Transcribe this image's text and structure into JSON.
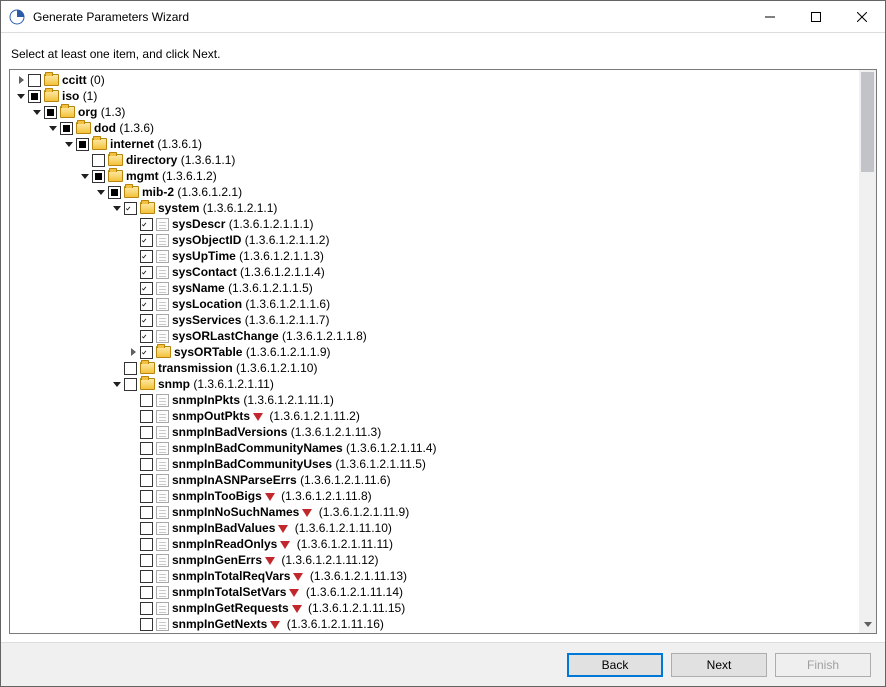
{
  "window": {
    "title": "Generate Parameters Wizard"
  },
  "instruction": "Select at least one item, and click Next.",
  "buttons": {
    "back": "Back",
    "next": "Next",
    "finish": "Finish"
  },
  "tree": [
    {
      "id": "ccitt",
      "depth": 0,
      "toggle": "collapsed",
      "check": "empty",
      "icon": "folder",
      "name": "ccitt",
      "oid": "(0)"
    },
    {
      "id": "iso",
      "depth": 0,
      "toggle": "expanded",
      "check": "partial",
      "icon": "folder",
      "name": "iso",
      "oid": "(1)"
    },
    {
      "id": "org",
      "depth": 1,
      "toggle": "expanded",
      "check": "partial",
      "icon": "folder",
      "name": "org",
      "oid": "(1.3)"
    },
    {
      "id": "dod",
      "depth": 2,
      "toggle": "expanded",
      "check": "partial",
      "icon": "folder",
      "name": "dod",
      "oid": "(1.3.6)"
    },
    {
      "id": "internet",
      "depth": 3,
      "toggle": "expanded",
      "check": "partial",
      "icon": "folder",
      "name": "internet",
      "oid": "(1.3.6.1)"
    },
    {
      "id": "directory",
      "depth": 4,
      "toggle": "none",
      "check": "empty",
      "icon": "folder",
      "name": "directory",
      "oid": "(1.3.6.1.1)"
    },
    {
      "id": "mgmt",
      "depth": 4,
      "toggle": "expanded",
      "check": "partial",
      "icon": "folder",
      "name": "mgmt",
      "oid": "(1.3.6.1.2)"
    },
    {
      "id": "mib2",
      "depth": 5,
      "toggle": "expanded",
      "check": "partial",
      "icon": "folder",
      "name": "mib-2",
      "oid": "(1.3.6.1.2.1)"
    },
    {
      "id": "system",
      "depth": 6,
      "toggle": "expanded",
      "check": "checked",
      "icon": "folder",
      "name": "system",
      "oid": "(1.3.6.1.2.1.1)"
    },
    {
      "id": "sysDescr",
      "depth": 7,
      "toggle": "none",
      "check": "checked",
      "icon": "leaf",
      "name": "sysDescr",
      "oid": "(1.3.6.1.2.1.1.1)"
    },
    {
      "id": "sysObjectID",
      "depth": 7,
      "toggle": "none",
      "check": "checked",
      "icon": "leaf",
      "name": "sysObjectID",
      "oid": "(1.3.6.1.2.1.1.2)"
    },
    {
      "id": "sysUpTime",
      "depth": 7,
      "toggle": "none",
      "check": "checked",
      "icon": "leaf",
      "name": "sysUpTime",
      "oid": "(1.3.6.1.2.1.1.3)"
    },
    {
      "id": "sysContact",
      "depth": 7,
      "toggle": "none",
      "check": "checked",
      "icon": "leaf",
      "name": "sysContact",
      "oid": "(1.3.6.1.2.1.1.4)"
    },
    {
      "id": "sysName",
      "depth": 7,
      "toggle": "none",
      "check": "checked",
      "icon": "leaf",
      "name": "sysName",
      "oid": "(1.3.6.1.2.1.1.5)"
    },
    {
      "id": "sysLocation",
      "depth": 7,
      "toggle": "none",
      "check": "checked",
      "icon": "leaf",
      "name": "sysLocation",
      "oid": "(1.3.6.1.2.1.1.6)"
    },
    {
      "id": "sysServices",
      "depth": 7,
      "toggle": "none",
      "check": "checked",
      "icon": "leaf",
      "name": "sysServices",
      "oid": "(1.3.6.1.2.1.1.7)"
    },
    {
      "id": "sysORLastChange",
      "depth": 7,
      "toggle": "none",
      "check": "checked",
      "icon": "leaf",
      "name": "sysORLastChange",
      "oid": "(1.3.6.1.2.1.1.8)"
    },
    {
      "id": "sysORTable",
      "depth": 7,
      "toggle": "collapsed",
      "check": "checked",
      "icon": "folder",
      "name": "sysORTable",
      "oid": "(1.3.6.1.2.1.1.9)"
    },
    {
      "id": "transmission",
      "depth": 6,
      "toggle": "none",
      "check": "empty",
      "icon": "folder",
      "name": "transmission",
      "oid": "(1.3.6.1.2.1.10)"
    },
    {
      "id": "snmp",
      "depth": 6,
      "toggle": "expanded",
      "check": "empty",
      "icon": "folder",
      "name": "snmp",
      "oid": "(1.3.6.1.2.1.11)"
    },
    {
      "id": "snmpInPkts",
      "depth": 7,
      "toggle": "none",
      "check": "empty",
      "icon": "leaf",
      "name": "snmpInPkts",
      "oid": "(1.3.6.1.2.1.11.1)"
    },
    {
      "id": "snmpOutPkts",
      "depth": 7,
      "toggle": "none",
      "check": "empty",
      "icon": "leaf",
      "name": "snmpOutPkts",
      "oid": "(1.3.6.1.2.1.11.2)",
      "deprecated": true
    },
    {
      "id": "snmpInBadVersions",
      "depth": 7,
      "toggle": "none",
      "check": "empty",
      "icon": "leaf",
      "name": "snmpInBadVersions",
      "oid": "(1.3.6.1.2.1.11.3)"
    },
    {
      "id": "snmpInBadCommunityNames",
      "depth": 7,
      "toggle": "none",
      "check": "empty",
      "icon": "leaf",
      "name": "snmpInBadCommunityNames",
      "oid": "(1.3.6.1.2.1.11.4)"
    },
    {
      "id": "snmpInBadCommunityUses",
      "depth": 7,
      "toggle": "none",
      "check": "empty",
      "icon": "leaf",
      "name": "snmpInBadCommunityUses",
      "oid": "(1.3.6.1.2.1.11.5)"
    },
    {
      "id": "snmpInASNParseErrs",
      "depth": 7,
      "toggle": "none",
      "check": "empty",
      "icon": "leaf",
      "name": "snmpInASNParseErrs",
      "oid": "(1.3.6.1.2.1.11.6)"
    },
    {
      "id": "snmpInTooBigs",
      "depth": 7,
      "toggle": "none",
      "check": "empty",
      "icon": "leaf",
      "name": "snmpInTooBigs",
      "oid": "(1.3.6.1.2.1.11.8)",
      "deprecated": true
    },
    {
      "id": "snmpInNoSuchNames",
      "depth": 7,
      "toggle": "none",
      "check": "empty",
      "icon": "leaf",
      "name": "snmpInNoSuchNames",
      "oid": "(1.3.6.1.2.1.11.9)",
      "deprecated": true
    },
    {
      "id": "snmpInBadValues",
      "depth": 7,
      "toggle": "none",
      "check": "empty",
      "icon": "leaf",
      "name": "snmpInBadValues",
      "oid": "(1.3.6.1.2.1.11.10)",
      "deprecated": true
    },
    {
      "id": "snmpInReadOnlys",
      "depth": 7,
      "toggle": "none",
      "check": "empty",
      "icon": "leaf",
      "name": "snmpInReadOnlys",
      "oid": "(1.3.6.1.2.1.11.11)",
      "deprecated": true
    },
    {
      "id": "snmpInGenErrs",
      "depth": 7,
      "toggle": "none",
      "check": "empty",
      "icon": "leaf",
      "name": "snmpInGenErrs",
      "oid": "(1.3.6.1.2.1.11.12)",
      "deprecated": true
    },
    {
      "id": "snmpInTotalReqVars",
      "depth": 7,
      "toggle": "none",
      "check": "empty",
      "icon": "leaf",
      "name": "snmpInTotalReqVars",
      "oid": "(1.3.6.1.2.1.11.13)",
      "deprecated": true
    },
    {
      "id": "snmpInTotalSetVars",
      "depth": 7,
      "toggle": "none",
      "check": "empty",
      "icon": "leaf",
      "name": "snmpInTotalSetVars",
      "oid": "(1.3.6.1.2.1.11.14)",
      "deprecated": true
    },
    {
      "id": "snmpInGetRequests",
      "depth": 7,
      "toggle": "none",
      "check": "empty",
      "icon": "leaf",
      "name": "snmpInGetRequests",
      "oid": "(1.3.6.1.2.1.11.15)",
      "deprecated": true
    },
    {
      "id": "snmpInGetNexts",
      "depth": 7,
      "toggle": "none",
      "check": "empty",
      "icon": "leaf",
      "name": "snmpInGetNexts",
      "oid": "(1.3.6.1.2.1.11.16)",
      "deprecated": true
    }
  ]
}
